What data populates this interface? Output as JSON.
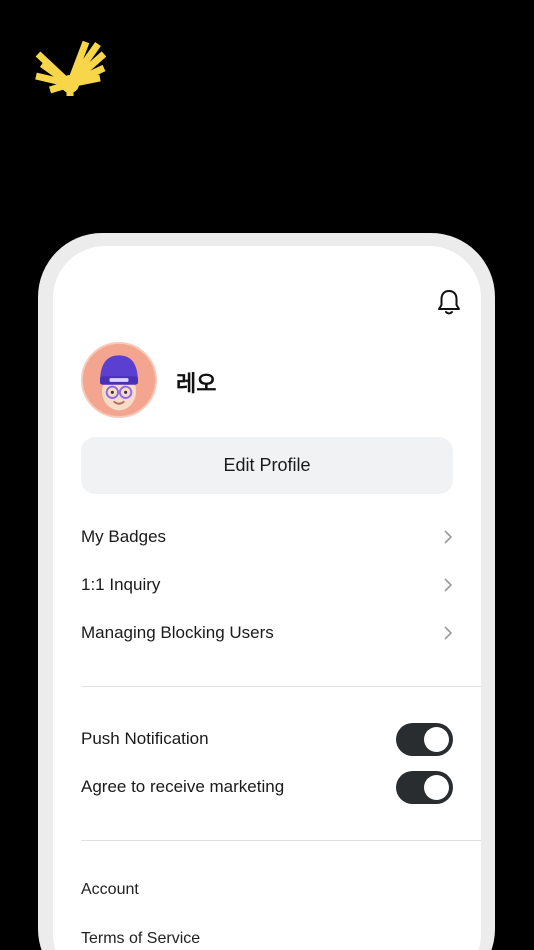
{
  "brand": {
    "logo_icon": "sunburst-logo-icon",
    "logo_color": "#f7d64a"
  },
  "header": {
    "notification_icon": "bell-icon"
  },
  "profile": {
    "name": "레오",
    "avatar_icon": "memoji-avatar",
    "avatar_bg": "#f4a58f",
    "edit_label": "Edit Profile"
  },
  "menu": {
    "items": [
      {
        "label": "My Badges"
      },
      {
        "label": "1:1 Inquiry"
      },
      {
        "label": "Managing Blocking Users"
      }
    ]
  },
  "settings": {
    "toggles": [
      {
        "label": "Push Notification",
        "on": true
      },
      {
        "label": "Agree to receive marketing",
        "on": true
      }
    ]
  },
  "links": [
    {
      "label": "Account"
    },
    {
      "label": "Terms of Service"
    }
  ],
  "colors": {
    "background": "#000000",
    "toggle_on": "#2a2d30",
    "button_bg": "#f1f2f4"
  }
}
